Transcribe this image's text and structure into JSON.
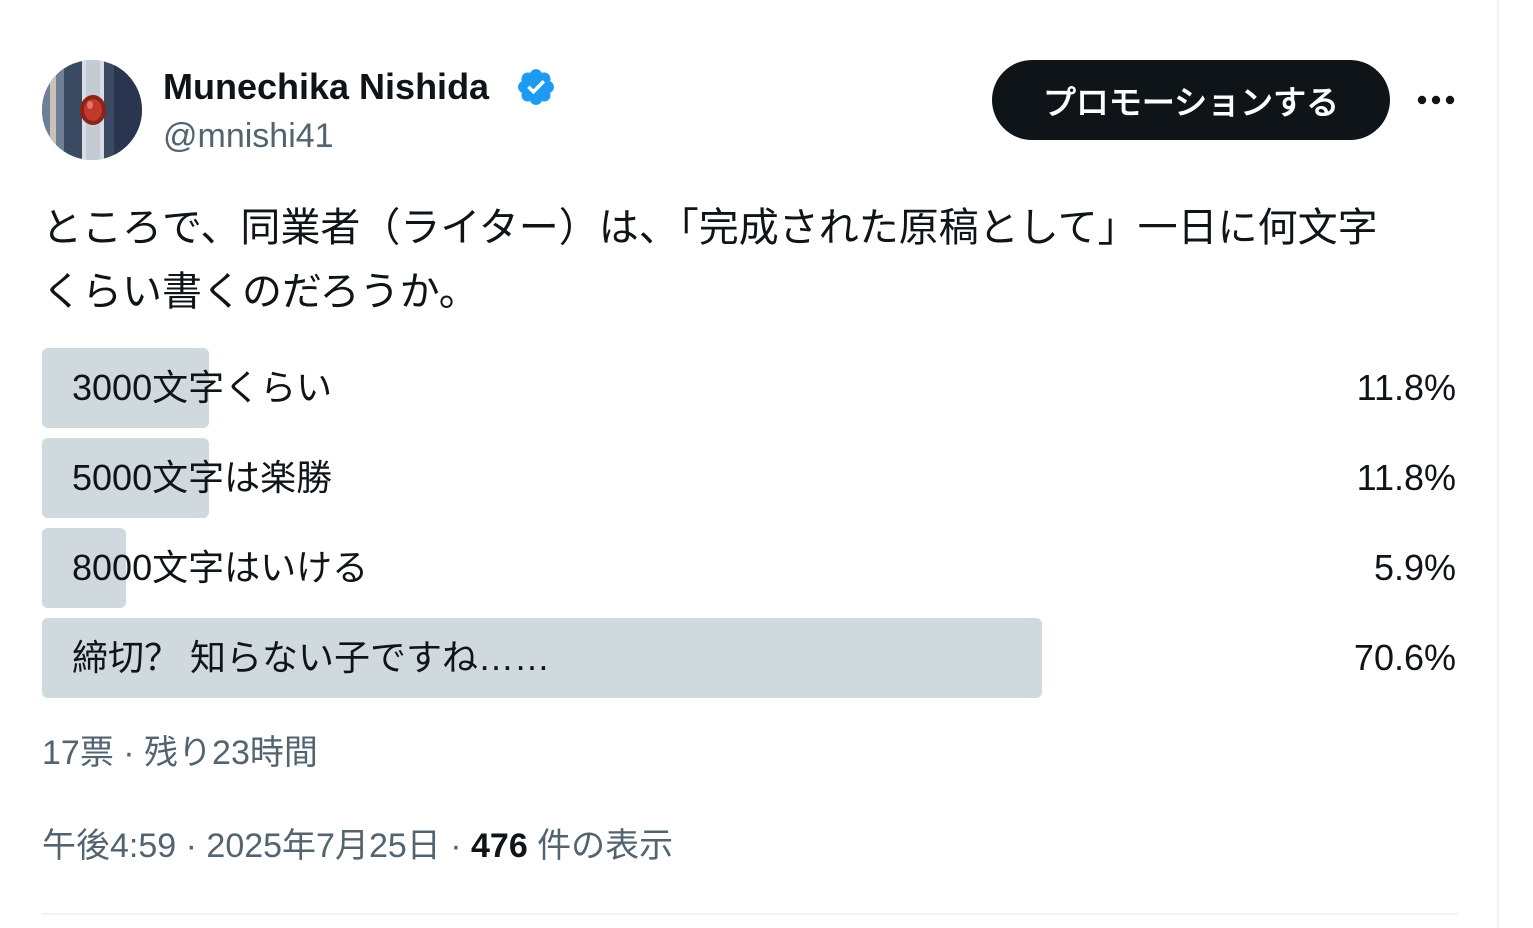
{
  "author": {
    "display_name": "Munechika Nishida",
    "handle": "@mnishi41",
    "verified": true
  },
  "header": {
    "promote_label": "プロモーションする"
  },
  "tweet": {
    "text": "ところで、同業者（ライター）は、「完成された原稿として」一日に何文字\nくらい書くのだろうか。"
  },
  "poll": {
    "options": [
      {
        "label": "3000文字くらい",
        "percent": "11.8%",
        "share": 0.118
      },
      {
        "label": "5000文字は楽勝",
        "percent": "11.8%",
        "share": 0.118
      },
      {
        "label": "8000文字はいける",
        "percent": "5.9%",
        "share": 0.059
      },
      {
        "label": "締切？ 知らない子ですね……",
        "percent": "70.6%",
        "share": 0.706
      }
    ],
    "meta": "17票 · 残り23時間"
  },
  "footer": {
    "time": "午後4:59",
    "separator": " · ",
    "date": "2025年7月25日",
    "views_count": "476",
    "views_label": " 件の表示"
  },
  "colors": {
    "text": "#0f1419",
    "secondary_text": "#536471",
    "poll_bar": "#cfd9de",
    "verified_badge": "#1d9bf0",
    "divider": "#eff3f4"
  },
  "icons": {
    "verified": "verified-badge-icon",
    "more": "more-horizontal-icon"
  }
}
